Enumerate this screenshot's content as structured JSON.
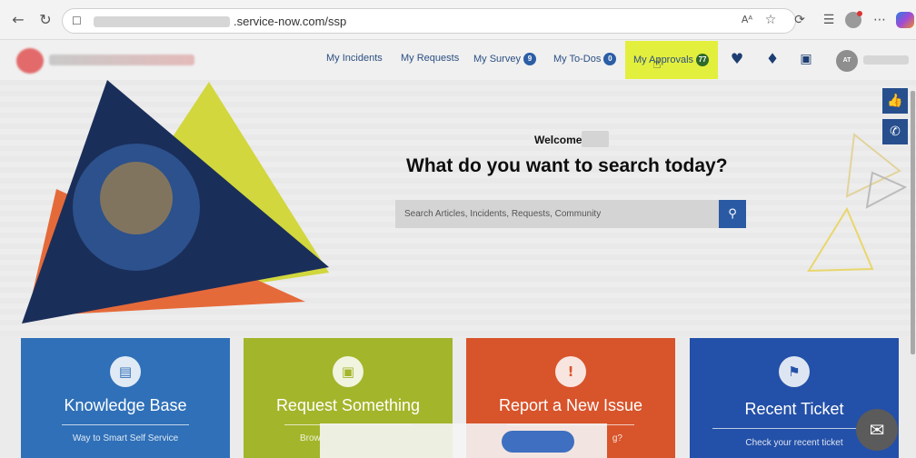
{
  "browser": {
    "url_text": ".service-now.com/ssp",
    "reader_icon": "Aᴬ"
  },
  "header": {
    "nav": [
      {
        "label": "My Incidents"
      },
      {
        "label": "My Requests"
      },
      {
        "label": "My Survey",
        "badge": "9"
      },
      {
        "label": "My To-Dos",
        "badge": "0"
      },
      {
        "label": "My Approvals",
        "badge": "77"
      }
    ],
    "avatar_initials": "AT"
  },
  "hero": {
    "welcome": "Welcome",
    "headline": "What do you want to search today?",
    "search_placeholder": "Search Articles, Incidents, Requests, Community"
  },
  "tiles": [
    {
      "title": "Knowledge Base",
      "subtitle": "Way to Smart Self Service",
      "color": "#2f70b8"
    },
    {
      "title": "Request Something",
      "subtitle": "Brow",
      "color": "#a3b52a"
    },
    {
      "title": "Report a New Issue",
      "subtitle": "g?",
      "color": "#d8542b"
    },
    {
      "title": "Recent Ticket",
      "subtitle": "Check your recent ticket",
      "color": "#2350a8"
    }
  ],
  "colors": {
    "approvals_highlight": "#e3ef3d",
    "nav_link": "#2b4f82",
    "search_button": "#2a5aa4"
  },
  "icons": [
    "back-arrow-icon",
    "refresh-icon",
    "lock-icon",
    "star-icon",
    "heart-icon",
    "bell-icon",
    "cart-icon",
    "search-icon",
    "thumbs-up-icon",
    "phone-icon",
    "chat-icon",
    "book-icon",
    "exclamation-icon",
    "tag-icon"
  ]
}
